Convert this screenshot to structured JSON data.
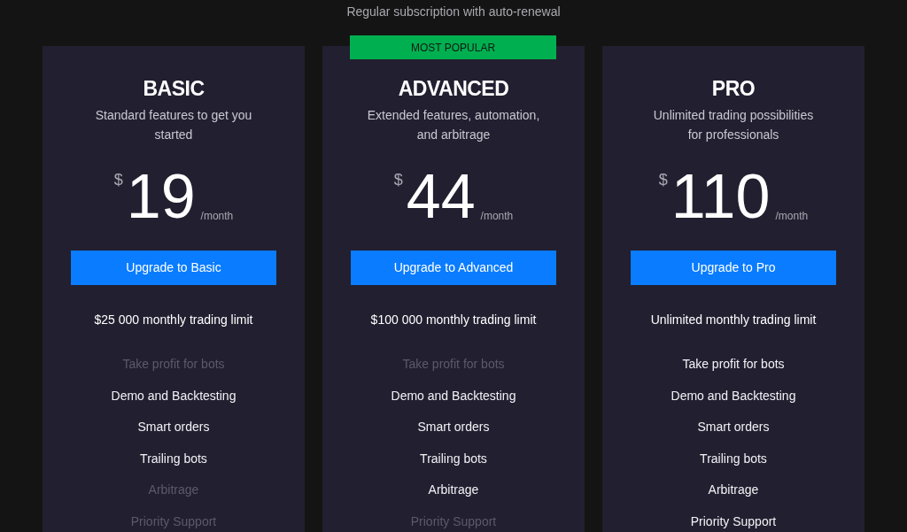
{
  "subtitle": "Regular subscription with auto-renewal",
  "plans": [
    {
      "name": "BASIC",
      "description": "Standard features to get you started",
      "currency": "$",
      "price": "19",
      "period": "/month",
      "button": "Upgrade to Basic",
      "limit": "$25 000 monthly trading limit",
      "features": [
        {
          "label": "Take profit for bots",
          "included": false
        },
        {
          "label": "Demo and Backtesting",
          "included": true
        },
        {
          "label": "Smart orders",
          "included": true
        },
        {
          "label": "Trailing bots",
          "included": true
        },
        {
          "label": "Arbitrage",
          "included": false
        },
        {
          "label": "Priority Support",
          "included": false
        }
      ]
    },
    {
      "name": "ADVANCED",
      "description": "Extended features, automation, and arbitrage",
      "currency": "$",
      "price": "44",
      "period": "/month",
      "badge": "MOST POPULAR",
      "button": "Upgrade to Advanced",
      "limit": "$100 000 monthly trading limit",
      "features": [
        {
          "label": "Take profit for bots",
          "included": false
        },
        {
          "label": "Demo and Backtesting",
          "included": true
        },
        {
          "label": "Smart orders",
          "included": true
        },
        {
          "label": "Trailing bots",
          "included": true
        },
        {
          "label": "Arbitrage",
          "included": true
        },
        {
          "label": "Priority Support",
          "included": false
        }
      ]
    },
    {
      "name": "PRO",
      "description": "Unlimited trading possibilities for professionals",
      "currency": "$",
      "price": "110",
      "period": "/month",
      "button": "Upgrade to Pro",
      "limit": "Unlimited monthly trading limit",
      "features": [
        {
          "label": "Take profit for bots",
          "included": true
        },
        {
          "label": "Demo and Backtesting",
          "included": true
        },
        {
          "label": "Smart orders",
          "included": true
        },
        {
          "label": "Trailing bots",
          "included": true
        },
        {
          "label": "Arbitrage",
          "included": true
        },
        {
          "label": "Priority Support",
          "included": true
        }
      ]
    }
  ]
}
